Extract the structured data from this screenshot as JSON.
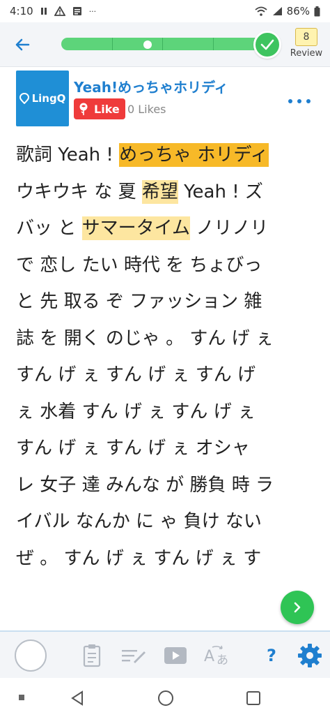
{
  "status_bar": {
    "time": "4:10",
    "extra": "···",
    "battery": "86%"
  },
  "toolbar": {
    "review_count": "8",
    "review_label": "Review"
  },
  "lesson": {
    "logo_text": "LingQ",
    "title": "Yeah!めっちゃホリディ",
    "like_label": "Like",
    "likes_count": "0 Likes"
  },
  "reader": {
    "lines": [
      [
        {
          "t": "歌詞"
        },
        {
          "t": " "
        },
        {
          "t": "Yeah"
        },
        {
          "t": " ! "
        },
        {
          "t": "めっちゃ",
          "hl": "orange"
        },
        {
          "t": " ",
          "hl": "orange"
        },
        {
          "t": "ホリディ",
          "hl": "orange"
        }
      ],
      [
        {
          "t": "ウキウキ"
        },
        {
          "t": " "
        },
        {
          "t": "な"
        },
        {
          "t": " "
        },
        {
          "t": "夏"
        },
        {
          "t": " "
        },
        {
          "t": "希望",
          "hl": "yellow"
        },
        {
          "t": " "
        },
        {
          "t": "Yeah"
        },
        {
          "t": " ! "
        },
        {
          "t": "ズ"
        }
      ],
      [
        {
          "t": "バッ"
        },
        {
          "t": " "
        },
        {
          "t": "と"
        },
        {
          "t": " "
        },
        {
          "t": "サマータイム",
          "hl": "yellow"
        },
        {
          "t": " "
        },
        {
          "t": "ノリノリ"
        }
      ],
      [
        {
          "t": "で"
        },
        {
          "t": " "
        },
        {
          "t": "恋し"
        },
        {
          "t": " "
        },
        {
          "t": "たい"
        },
        {
          "t": " "
        },
        {
          "t": "時代"
        },
        {
          "t": " "
        },
        {
          "t": "を"
        },
        {
          "t": " "
        },
        {
          "t": "ちょびっ"
        }
      ],
      [
        {
          "t": "と"
        },
        {
          "t": " "
        },
        {
          "t": "先"
        },
        {
          "t": " "
        },
        {
          "t": "取る"
        },
        {
          "t": " "
        },
        {
          "t": "ぞ"
        },
        {
          "t": " "
        },
        {
          "t": "ファッション"
        },
        {
          "t": " "
        },
        {
          "t": "雑"
        }
      ],
      [
        {
          "t": "誌"
        },
        {
          "t": " "
        },
        {
          "t": "を"
        },
        {
          "t": " "
        },
        {
          "t": "開く"
        },
        {
          "t": " "
        },
        {
          "t": "のじゃ"
        },
        {
          "t": " 。 "
        },
        {
          "t": "すん"
        },
        {
          "t": " "
        },
        {
          "t": "げ"
        },
        {
          "t": " "
        },
        {
          "t": "ぇ"
        }
      ],
      [
        {
          "t": "すん"
        },
        {
          "t": " "
        },
        {
          "t": "げ"
        },
        {
          "t": " "
        },
        {
          "t": "ぇ"
        },
        {
          "t": " "
        },
        {
          "t": "すん"
        },
        {
          "t": " "
        },
        {
          "t": "げ"
        },
        {
          "t": " "
        },
        {
          "t": "ぇ"
        },
        {
          "t": " "
        },
        {
          "t": "すん"
        },
        {
          "t": " "
        },
        {
          "t": "げ"
        }
      ],
      [
        {
          "t": "ぇ"
        },
        {
          "t": " "
        },
        {
          "t": "水着"
        },
        {
          "t": " "
        },
        {
          "t": "すん"
        },
        {
          "t": " "
        },
        {
          "t": "げ"
        },
        {
          "t": " "
        },
        {
          "t": "ぇ"
        },
        {
          "t": " "
        },
        {
          "t": "すん"
        },
        {
          "t": " "
        },
        {
          "t": "げ"
        },
        {
          "t": " "
        },
        {
          "t": "ぇ"
        }
      ],
      [
        {
          "t": "すん"
        },
        {
          "t": " "
        },
        {
          "t": "げ"
        },
        {
          "t": " "
        },
        {
          "t": "ぇ"
        },
        {
          "t": " "
        },
        {
          "t": "すん"
        },
        {
          "t": " "
        },
        {
          "t": "げ"
        },
        {
          "t": " "
        },
        {
          "t": "ぇ"
        },
        {
          "t": " "
        },
        {
          "t": "オシャ"
        }
      ],
      [
        {
          "t": "レ"
        },
        {
          "t": " "
        },
        {
          "t": "女子"
        },
        {
          "t": " "
        },
        {
          "t": "達"
        },
        {
          "t": " "
        },
        {
          "t": "みんな"
        },
        {
          "t": " "
        },
        {
          "t": "が"
        },
        {
          "t": " "
        },
        {
          "t": "勝負"
        },
        {
          "t": " "
        },
        {
          "t": "時"
        },
        {
          "t": " "
        },
        {
          "t": "ラ"
        }
      ],
      [
        {
          "t": "イバル"
        },
        {
          "t": " "
        },
        {
          "t": "なんか"
        },
        {
          "t": " "
        },
        {
          "t": "に"
        },
        {
          "t": " "
        },
        {
          "t": "ゃ"
        },
        {
          "t": " "
        },
        {
          "t": "負け"
        },
        {
          "t": " "
        },
        {
          "t": "ない"
        }
      ],
      [
        {
          "t": "ぜ"
        },
        {
          "t": " 。 "
        },
        {
          "t": "すん"
        },
        {
          "t": " "
        },
        {
          "t": "げ"
        },
        {
          "t": " "
        },
        {
          "t": "ぇ"
        },
        {
          "t": " "
        },
        {
          "t": "すん"
        },
        {
          "t": " "
        },
        {
          "t": "げ"
        },
        {
          "t": " "
        },
        {
          "t": "ぇ"
        },
        {
          "t": " "
        },
        {
          "t": "す"
        }
      ]
    ]
  },
  "bottom_toolbar": {
    "help_label": "?"
  },
  "colors": {
    "accent": "#1f7fcf",
    "progress": "#5dd47a",
    "highlight_orange": "#f7b928",
    "highlight_yellow": "#fde6a0",
    "like_red": "#ef3b3b",
    "fab_green": "#2fc455"
  },
  "icons": {
    "status": [
      "pause-icon",
      "warning-icon",
      "news-icon",
      "wifi-icon",
      "signal-icon",
      "battery-icon"
    ],
    "toolbar": [
      "back-arrow-icon",
      "check-icon"
    ],
    "bottom": [
      "clipboard-icon",
      "edit-lines-icon",
      "video-icon",
      "translate-icon",
      "help-icon",
      "gear-icon"
    ],
    "nav": [
      "recents-icon",
      "back-triangle-icon",
      "home-circle-icon",
      "overview-square-icon"
    ]
  }
}
